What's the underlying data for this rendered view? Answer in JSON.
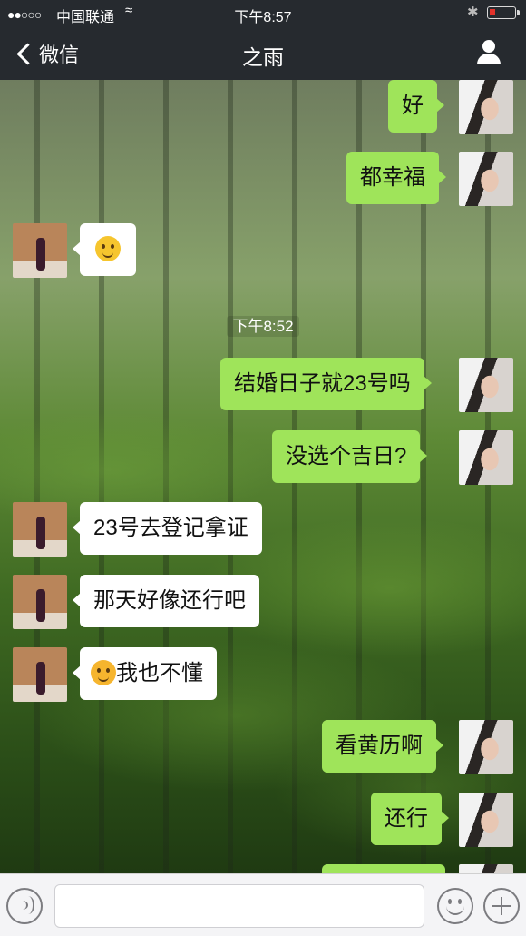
{
  "status_bar": {
    "signal": "●●○○○",
    "carrier": "中国联通",
    "time": "下午8:57"
  },
  "nav": {
    "back_label": "微信",
    "title": "之雨"
  },
  "timestamp": "下午8:52",
  "messages": [
    {
      "side": "right",
      "text": "好"
    },
    {
      "side": "right",
      "text": "都幸福"
    },
    {
      "side": "left",
      "text": "",
      "emoji": "grinning-emoji"
    },
    {
      "side": "right",
      "text": "结婚日子就23号吗"
    },
    {
      "side": "right",
      "text": "没选个吉日?"
    },
    {
      "side": "left",
      "text": "23号去登记拿证"
    },
    {
      "side": "left",
      "text": "那天好像还行吧"
    },
    {
      "side": "left",
      "text": "我也不懂",
      "emoji": "crying-laughing-emoji"
    },
    {
      "side": "right",
      "text": "看黄历啊"
    },
    {
      "side": "right",
      "text": "还行"
    }
  ],
  "colors": {
    "sent_bubble": "#9fe45a",
    "received_bubble": "#ffffff",
    "nav_bg": "#262a2f"
  }
}
